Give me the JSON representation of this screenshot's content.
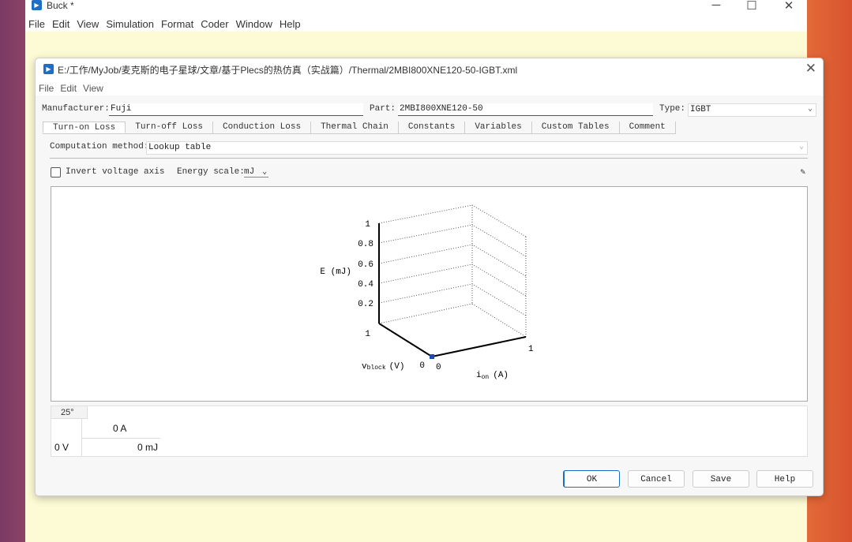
{
  "main_window": {
    "title": "Buck *",
    "menu": [
      "File",
      "Edit",
      "View",
      "Simulation",
      "Format",
      "Coder",
      "Window",
      "Help"
    ],
    "controls": {
      "minimize": "─",
      "maximize": "☐",
      "close": "✕"
    }
  },
  "dialog": {
    "title": "E:/工作/MyJob/麦克斯的电子星球/文章/基于Plecs的热仿真（实战篇）/Thermal/2MBI800XNE120-50-IGBT.xml",
    "menu": [
      "File",
      "Edit",
      "View"
    ],
    "fields": {
      "manufacturer_label": "Manufacturer:",
      "manufacturer_value": "Fuji",
      "part_label": "Part:",
      "part_value": "2MBI800XNE120-50",
      "type_label": "Type:",
      "type_value": "IGBT"
    },
    "tabs": [
      "Turn-on Loss",
      "Turn-off Loss",
      "Conduction Loss",
      "Thermal Chain",
      "Constants",
      "Variables",
      "Custom Tables",
      "Comment"
    ],
    "active_tab": "Turn-on Loss",
    "computation": {
      "label": "Computation method:",
      "value": "Lookup table"
    },
    "options": {
      "invert_label": "Invert voltage axis",
      "invert_checked": false,
      "energy_label": "Energy scale:",
      "energy_value": "mJ"
    },
    "plot": {
      "z_label": "E (mJ)",
      "z_ticks": [
        "0.2",
        "0.4",
        "0.6",
        "0.8",
        "1"
      ],
      "vblock_label": "v",
      "vblock_sub": "block",
      "vblock_unit": "(V)",
      "ion_label": "i",
      "ion_sub": "on",
      "ion_unit": "(A)",
      "vblock_tick_far": "1",
      "vblock_tick_origin": "0",
      "ion_tick_origin": "0",
      "ion_tick_far": "1"
    },
    "table": {
      "temperature": "25°",
      "current": "0 A",
      "voltage": "0 V",
      "energy": "0 mJ"
    },
    "buttons": {
      "ok": "OK",
      "cancel": "Cancel",
      "save": "Save",
      "help": "Help"
    }
  }
}
